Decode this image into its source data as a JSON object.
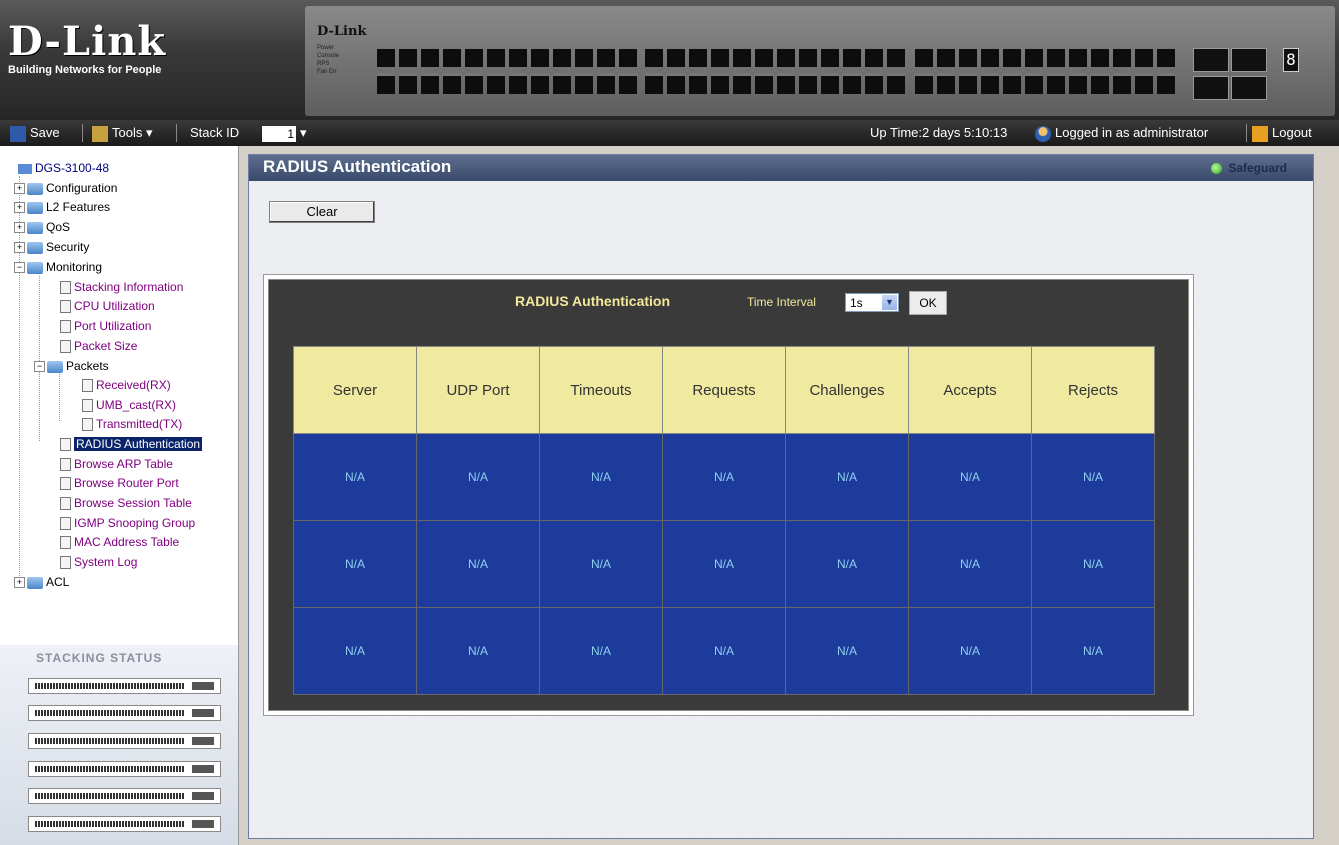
{
  "branding": {
    "logo": "D-Link",
    "tagline": "Building Networks for People",
    "device_brand": "D-Link",
    "device_leds": [
      "Power",
      "Console",
      "RPS",
      "Fan Err"
    ],
    "seg_display": "8"
  },
  "toolbar": {
    "save_label": "Save",
    "tools_label": "Tools",
    "stack_id_label": "Stack ID",
    "stack_id_value": "1",
    "uptime": "Up Time:2 days 5:10:13",
    "logged_in": "Logged in as administrator",
    "logout_label": "Logout"
  },
  "sidebar": {
    "root": "DGS-3100-48",
    "items": [
      {
        "label": "Configuration"
      },
      {
        "label": "L2 Features"
      },
      {
        "label": "QoS"
      },
      {
        "label": "Security"
      },
      {
        "label": "Monitoring"
      },
      {
        "label": "Stacking Information"
      },
      {
        "label": "CPU Utilization"
      },
      {
        "label": "Port Utilization"
      },
      {
        "label": "Packet Size"
      },
      {
        "label": "Packets"
      },
      {
        "label": "Received(RX)"
      },
      {
        "label": "UMB_cast(RX)"
      },
      {
        "label": "Transmitted(TX)"
      },
      {
        "label": "RADIUS Authentication"
      },
      {
        "label": "Browse ARP Table"
      },
      {
        "label": "Browse Router Port"
      },
      {
        "label": "Browse Session Table"
      },
      {
        "label": "IGMP Snooping Group"
      },
      {
        "label": "MAC Address Table"
      },
      {
        "label": "System Log"
      },
      {
        "label": "ACL"
      }
    ]
  },
  "stacking_status": {
    "title": "Stacking Status"
  },
  "main": {
    "title": "RADIUS Authentication",
    "safeguard": "Safeguard",
    "clear_label": "Clear",
    "panel_title": "RADIUS Authentication",
    "time_interval_label": "Time Interval",
    "time_interval_value": "1s",
    "ok_label": "OK",
    "table": {
      "headers": [
        "Server",
        "UDP Port",
        "Timeouts",
        "Requests",
        "Challenges",
        "Accepts",
        "Rejects"
      ],
      "rows": [
        [
          "N/A",
          "N/A",
          "N/A",
          "N/A",
          "N/A",
          "N/A",
          "N/A"
        ],
        [
          "N/A",
          "N/A",
          "N/A",
          "N/A",
          "N/A",
          "N/A",
          "N/A"
        ],
        [
          "N/A",
          "N/A",
          "N/A",
          "N/A",
          "N/A",
          "N/A",
          "N/A"
        ]
      ]
    }
  }
}
